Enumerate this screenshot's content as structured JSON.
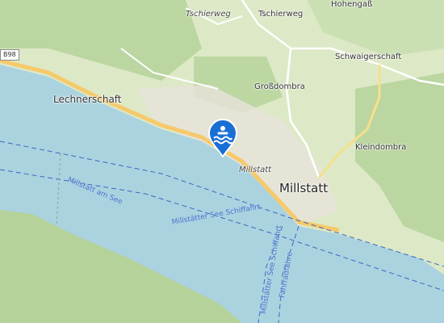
{
  "map": {
    "places": {
      "tschierweg_road": "Tschierweg",
      "tschierweg": "Tschierweg",
      "hohengass": "Hohengaß",
      "schwaigerschaft": "Schwaigerschaft",
      "grossdombra": "Großdombra",
      "lechnerschaft": "Lechnerschaft",
      "kleindombra": "Kleindombra",
      "millstatt_road": "Millstatt",
      "millstatt": "Millstatt"
    },
    "road_shield": "B98",
    "water_labels": {
      "ferry_main": "Millstätter See Schiffahrt",
      "ferry_am_see": "Millstatt am See",
      "ferry_vertical": "Millstätter See Schiffahrt",
      "faehre": "Fahrradfähre"
    },
    "marker_icon": "swimming-icon",
    "colors": {
      "land": "#dde9c6",
      "forest": "#b5d29a",
      "water": "#aad3df",
      "road_major": "#f6c96b",
      "road_minor": "#ffffff",
      "marker": "#1a6fd6",
      "urban": "#e7e2da"
    }
  }
}
